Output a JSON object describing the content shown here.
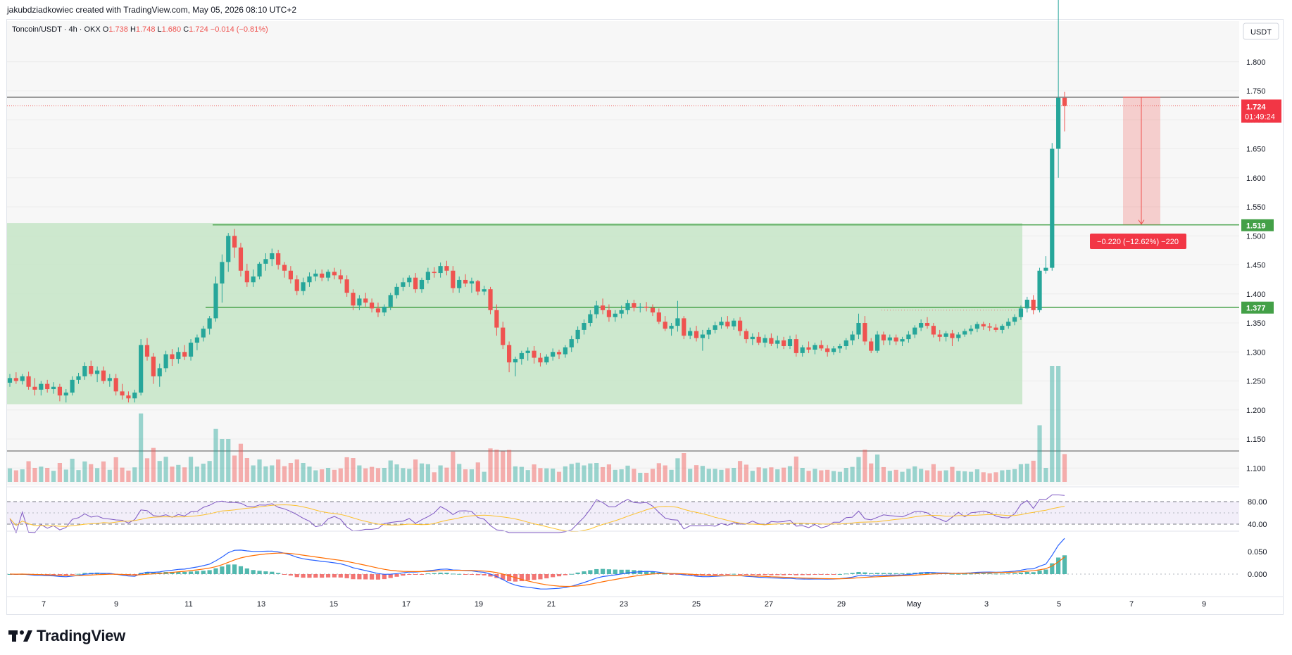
{
  "header": {
    "credit": "jakubdziadkowiec created with TradingView.com, May 05, 2026 08:10 UTC+2"
  },
  "legend": {
    "symbol": "Toncoin/USDT · 4h · OKX",
    "o_label": "O",
    "o_value": "1.738",
    "h_label": "H",
    "h_value": "1.748",
    "l_label": "L",
    "l_value": "1.680",
    "c_label": "C",
    "c_value": "1.724",
    "change": "−0.014 (−0.81%)"
  },
  "price_axis": {
    "currency": "USDT",
    "ticks": [
      "1.800",
      "1.750",
      "1.700",
      "1.650",
      "1.600",
      "1.550",
      "1.500",
      "1.450",
      "1.400",
      "1.350",
      "1.300",
      "1.250",
      "1.200",
      "1.150",
      "1.100"
    ],
    "last_price": "1.724",
    "countdown": "01:49:24",
    "level_high": "1.519",
    "level_low": "1.377"
  },
  "time_axis": {
    "ticks": [
      "7",
      "9",
      "11",
      "13",
      "15",
      "17",
      "19",
      "21",
      "23",
      "25",
      "27",
      "29",
      "May",
      "3",
      "5",
      "7",
      "9"
    ]
  },
  "measure": {
    "label": "−0.220 (−12.62%) −220"
  },
  "rsi": {
    "ticks": [
      "80.00",
      "40.00"
    ]
  },
  "macd": {
    "ticks": [
      "0.050",
      "0.000"
    ]
  },
  "brand": {
    "name": "TradingView"
  },
  "colors": {
    "up": "#26a69a",
    "down": "#ef5350",
    "zone": "#c8e6c9",
    "level": "#43a047",
    "rsi_line": "#7e57c2",
    "rsi_ma": "#fbc02d",
    "macd_line": "#2962ff",
    "signal_line": "#ff6d00"
  },
  "chart_data": {
    "type": "candlestick",
    "timeframe": "4h",
    "symbol": "Toncoin/USDT",
    "ylim": [
      1.07,
      1.87
    ],
    "candles": [
      [
        1.247,
        1.262,
        1.24,
        1.255
      ],
      [
        1.255,
        1.265,
        1.245,
        1.25
      ],
      [
        1.25,
        1.262,
        1.244,
        1.258
      ],
      [
        1.258,
        1.266,
        1.235,
        1.24
      ],
      [
        1.24,
        1.255,
        1.225,
        1.235
      ],
      [
        1.235,
        1.25,
        1.225,
        1.245
      ],
      [
        1.245,
        1.252,
        1.23,
        1.236
      ],
      [
        1.236,
        1.248,
        1.228,
        1.24
      ],
      [
        1.24,
        1.245,
        1.215,
        1.225
      ],
      [
        1.225,
        1.236,
        1.213,
        1.23
      ],
      [
        1.23,
        1.258,
        1.225,
        1.252
      ],
      [
        1.252,
        1.264,
        1.245,
        1.258
      ],
      [
        1.258,
        1.282,
        1.252,
        1.276
      ],
      [
        1.276,
        1.285,
        1.258,
        1.262
      ],
      [
        1.262,
        1.275,
        1.248,
        1.268
      ],
      [
        1.268,
        1.275,
        1.245,
        1.25
      ],
      [
        1.25,
        1.262,
        1.24,
        1.255
      ],
      [
        1.255,
        1.262,
        1.225,
        1.232
      ],
      [
        1.232,
        1.245,
        1.218,
        1.225
      ],
      [
        1.225,
        1.232,
        1.213,
        1.22
      ],
      [
        1.22,
        1.235,
        1.213,
        1.23
      ],
      [
        1.23,
        1.322,
        1.225,
        1.312
      ],
      [
        1.312,
        1.324,
        1.285,
        1.292
      ],
      [
        1.292,
        1.298,
        1.245,
        1.258
      ],
      [
        1.258,
        1.28,
        1.24,
        1.272
      ],
      [
        1.272,
        1.302,
        1.265,
        1.296
      ],
      [
        1.296,
        1.305,
        1.276,
        1.288
      ],
      [
        1.288,
        1.308,
        1.28,
        1.3
      ],
      [
        1.3,
        1.312,
        1.286,
        1.292
      ],
      [
        1.292,
        1.322,
        1.285,
        1.316
      ],
      [
        1.316,
        1.33,
        1.303,
        1.325
      ],
      [
        1.325,
        1.345,
        1.318,
        1.34
      ],
      [
        1.34,
        1.362,
        1.33,
        1.358
      ],
      [
        1.358,
        1.43,
        1.352,
        1.418
      ],
      [
        1.418,
        1.468,
        1.385,
        1.455
      ],
      [
        1.455,
        1.505,
        1.438,
        1.5
      ],
      [
        1.5,
        1.512,
        1.462,
        1.48
      ],
      [
        1.48,
        1.488,
        1.43,
        1.44
      ],
      [
        1.44,
        1.452,
        1.412,
        1.42
      ],
      [
        1.42,
        1.442,
        1.412,
        1.43
      ],
      [
        1.43,
        1.455,
        1.425,
        1.452
      ],
      [
        1.452,
        1.47,
        1.44,
        1.46
      ],
      [
        1.46,
        1.478,
        1.448,
        1.47
      ],
      [
        1.47,
        1.476,
        1.442,
        1.45
      ],
      [
        1.45,
        1.455,
        1.428,
        1.44
      ],
      [
        1.44,
        1.448,
        1.418,
        1.425
      ],
      [
        1.425,
        1.432,
        1.398,
        1.405
      ],
      [
        1.405,
        1.428,
        1.398,
        1.42
      ],
      [
        1.42,
        1.437,
        1.412,
        1.43
      ],
      [
        1.43,
        1.442,
        1.422,
        1.435
      ],
      [
        1.435,
        1.442,
        1.422,
        1.428
      ],
      [
        1.428,
        1.442,
        1.422,
        1.438
      ],
      [
        1.438,
        1.445,
        1.425,
        1.432
      ],
      [
        1.432,
        1.442,
        1.418,
        1.425
      ],
      [
        1.425,
        1.432,
        1.395,
        1.402
      ],
      [
        1.402,
        1.408,
        1.372,
        1.38
      ],
      [
        1.38,
        1.398,
        1.372,
        1.392
      ],
      [
        1.392,
        1.402,
        1.378,
        1.385
      ],
      [
        1.385,
        1.392,
        1.368,
        1.375
      ],
      [
        1.375,
        1.385,
        1.36,
        1.368
      ],
      [
        1.368,
        1.382,
        1.362,
        1.378
      ],
      [
        1.378,
        1.402,
        1.372,
        1.398
      ],
      [
        1.398,
        1.418,
        1.392,
        1.412
      ],
      [
        1.412,
        1.428,
        1.405,
        1.42
      ],
      [
        1.42,
        1.432,
        1.412,
        1.428
      ],
      [
        1.428,
        1.436,
        1.402,
        1.408
      ],
      [
        1.408,
        1.428,
        1.402,
        1.424
      ],
      [
        1.424,
        1.445,
        1.418,
        1.438
      ],
      [
        1.438,
        1.446,
        1.428,
        1.436
      ],
      [
        1.436,
        1.454,
        1.428,
        1.448
      ],
      [
        1.448,
        1.457,
        1.432,
        1.44
      ],
      [
        1.44,
        1.448,
        1.402,
        1.41
      ],
      [
        1.41,
        1.43,
        1.402,
        1.424
      ],
      [
        1.424,
        1.434,
        1.412,
        1.418
      ],
      [
        1.418,
        1.428,
        1.402,
        1.422
      ],
      [
        1.422,
        1.424,
        1.398,
        1.404
      ],
      [
        1.404,
        1.414,
        1.398,
        1.408
      ],
      [
        1.408,
        1.412,
        1.365,
        1.372
      ],
      [
        1.372,
        1.382,
        1.328,
        1.342
      ],
      [
        1.342,
        1.352,
        1.305,
        1.312
      ],
      [
        1.312,
        1.318,
        1.265,
        1.282
      ],
      [
        1.282,
        1.292,
        1.258,
        1.288
      ],
      [
        1.288,
        1.302,
        1.278,
        1.298
      ],
      [
        1.298,
        1.308,
        1.285,
        1.302
      ],
      [
        1.302,
        1.31,
        1.28,
        1.29
      ],
      [
        1.29,
        1.298,
        1.275,
        1.282
      ],
      [
        1.282,
        1.296,
        1.278,
        1.292
      ],
      [
        1.292,
        1.306,
        1.285,
        1.3
      ],
      [
        1.3,
        1.304,
        1.288,
        1.296
      ],
      [
        1.296,
        1.312,
        1.29,
        1.308
      ],
      [
        1.308,
        1.328,
        1.3,
        1.322
      ],
      [
        1.322,
        1.344,
        1.315,
        1.338
      ],
      [
        1.338,
        1.356,
        1.33,
        1.35
      ],
      [
        1.35,
        1.372,
        1.344,
        1.365
      ],
      [
        1.365,
        1.388,
        1.358,
        1.38
      ],
      [
        1.38,
        1.392,
        1.365,
        1.372
      ],
      [
        1.372,
        1.382,
        1.352,
        1.36
      ],
      [
        1.36,
        1.372,
        1.352,
        1.366
      ],
      [
        1.366,
        1.38,
        1.358,
        1.372
      ],
      [
        1.372,
        1.39,
        1.365,
        1.384
      ],
      [
        1.384,
        1.39,
        1.37,
        1.376
      ],
      [
        1.376,
        1.384,
        1.368,
        1.378
      ],
      [
        1.378,
        1.386,
        1.37,
        1.376
      ],
      [
        1.376,
        1.382,
        1.362,
        1.368
      ],
      [
        1.368,
        1.375,
        1.348,
        1.352
      ],
      [
        1.352,
        1.362,
        1.336,
        1.34
      ],
      [
        1.34,
        1.35,
        1.328,
        1.345
      ],
      [
        1.345,
        1.388,
        1.335,
        1.358
      ],
      [
        1.358,
        1.362,
        1.322,
        1.328
      ],
      [
        1.328,
        1.342,
        1.322,
        1.336
      ],
      [
        1.336,
        1.345,
        1.318,
        1.324
      ],
      [
        1.324,
        1.338,
        1.302,
        1.33
      ],
      [
        1.33,
        1.342,
        1.322,
        1.338
      ],
      [
        1.338,
        1.352,
        1.332,
        1.346
      ],
      [
        1.346,
        1.36,
        1.34,
        1.352
      ],
      [
        1.352,
        1.362,
        1.34,
        1.344
      ],
      [
        1.344,
        1.358,
        1.338,
        1.354
      ],
      [
        1.354,
        1.36,
        1.328,
        1.336
      ],
      [
        1.336,
        1.34,
        1.315,
        1.322
      ],
      [
        1.322,
        1.332,
        1.312,
        1.326
      ],
      [
        1.326,
        1.334,
        1.312,
        1.316
      ],
      [
        1.316,
        1.33,
        1.308,
        1.324
      ],
      [
        1.324,
        1.332,
        1.31,
        1.314
      ],
      [
        1.314,
        1.328,
        1.306,
        1.32
      ],
      [
        1.32,
        1.326,
        1.305,
        1.31
      ],
      [
        1.31,
        1.328,
        1.305,
        1.322
      ],
      [
        1.322,
        1.33,
        1.292,
        1.298
      ],
      [
        1.298,
        1.312,
        1.292,
        1.308
      ],
      [
        1.308,
        1.318,
        1.298,
        1.304
      ],
      [
        1.304,
        1.316,
        1.296,
        1.312
      ],
      [
        1.312,
        1.32,
        1.302,
        1.306
      ],
      [
        1.306,
        1.312,
        1.292,
        1.3
      ],
      [
        1.3,
        1.31,
        1.295,
        1.306
      ],
      [
        1.306,
        1.314,
        1.298,
        1.31
      ],
      [
        1.31,
        1.324,
        1.304,
        1.32
      ],
      [
        1.32,
        1.336,
        1.312,
        1.33
      ],
      [
        1.33,
        1.366,
        1.322,
        1.35
      ],
      [
        1.35,
        1.362,
        1.312,
        1.318
      ],
      [
        1.318,
        1.324,
        1.298,
        1.302
      ],
      [
        1.302,
        1.336,
        1.298,
        1.33
      ],
      [
        1.33,
        1.335,
        1.312,
        1.32
      ],
      [
        1.32,
        1.33,
        1.312,
        1.325
      ],
      [
        1.325,
        1.33,
        1.312,
        1.318
      ],
      [
        1.318,
        1.326,
        1.31,
        1.322
      ],
      [
        1.322,
        1.336,
        1.316,
        1.33
      ],
      [
        1.33,
        1.346,
        1.324,
        1.342
      ],
      [
        1.342,
        1.356,
        1.336,
        1.35
      ],
      [
        1.35,
        1.36,
        1.34,
        1.345
      ],
      [
        1.345,
        1.35,
        1.325,
        1.33
      ],
      [
        1.33,
        1.338,
        1.318,
        1.326
      ],
      [
        1.326,
        1.336,
        1.318,
        1.332
      ],
      [
        1.332,
        1.338,
        1.31,
        1.324
      ],
      [
        1.324,
        1.334,
        1.318,
        1.33
      ],
      [
        1.33,
        1.34,
        1.326,
        1.336
      ],
      [
        1.336,
        1.346,
        1.33,
        1.34
      ],
      [
        1.34,
        1.352,
        1.334,
        1.348
      ],
      [
        1.348,
        1.352,
        1.338,
        1.344
      ],
      [
        1.344,
        1.35,
        1.336,
        1.342
      ],
      [
        1.342,
        1.348,
        1.334,
        1.338
      ],
      [
        1.338,
        1.348,
        1.332,
        1.345
      ],
      [
        1.345,
        1.358,
        1.34,
        1.352
      ],
      [
        1.352,
        1.365,
        1.346,
        1.36
      ],
      [
        1.36,
        1.38,
        1.355,
        1.375
      ],
      [
        1.375,
        1.395,
        1.368,
        1.39
      ],
      [
        1.39,
        1.398,
        1.365,
        1.372
      ],
      [
        1.372,
        1.445,
        1.368,
        1.44
      ],
      [
        1.44,
        1.465,
        1.435,
        1.445
      ],
      [
        1.445,
        1.66,
        1.44,
        1.65
      ],
      [
        1.65,
        1.955,
        1.6,
        1.738
      ],
      [
        1.738,
        1.748,
        1.68,
        1.724
      ]
    ],
    "volume_up_ratio": "volume bars coloured by candle direction",
    "levels": [
      1.519,
      1.377
    ],
    "consolidation_zone": [
      1.21,
      1.522
    ],
    "measured_move": {
      "from": 1.739,
      "to": 1.519,
      "change": "−0.220 (−12.62%) −220"
    }
  }
}
